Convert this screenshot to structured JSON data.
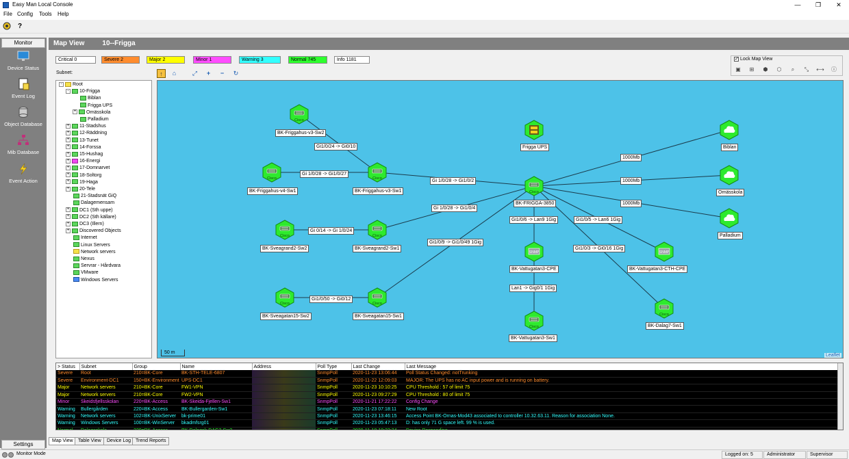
{
  "window": {
    "title": "Easy Man Local Console",
    "minimize": "—",
    "restore": "❐",
    "close": "✕"
  },
  "menu": {
    "file": "File",
    "config": "Config",
    "tools": "Tools",
    "help": "Help"
  },
  "toolbar": {
    "settings_icon": "gear-icon",
    "help_label": "?"
  },
  "monitor": {
    "header": "Monitor",
    "settings": "Settings",
    "items": [
      {
        "label": "Device Status",
        "icon": "monitor-icon"
      },
      {
        "label": "Event Log",
        "icon": "log-icon"
      },
      {
        "label": "Object Database",
        "icon": "database-icon"
      },
      {
        "label": "Mib Database",
        "icon": "network-icon"
      },
      {
        "label": "Event Action",
        "icon": "lightning-icon"
      }
    ]
  },
  "map_header": {
    "title": "Map View",
    "subtitle": "10--Frigga"
  },
  "severity": {
    "critical": "Critical 0",
    "severe": "Severe 2",
    "major": "Major 2",
    "minor": "Minor 1",
    "warning": "Warning 3",
    "normal": "Normal 745",
    "info": "Info 1181",
    "colors": {
      "critical": "#ffffff",
      "severe": "#ff8c2e",
      "major": "#ffff00",
      "minor": "#ff4dff",
      "warning": "#33ffff",
      "normal": "#2eff2e",
      "info": "#ffffff"
    }
  },
  "subnet_label": "Subnet:",
  "tree": [
    {
      "label": "Root",
      "exp": "-",
      "folder": "yellow"
    },
    {
      "label": "10-Frigga",
      "exp": "-",
      "folder": "green"
    },
    {
      "label": "Biblan",
      "exp": "",
      "folder": "green"
    },
    {
      "label": "Frigga UPS",
      "exp": "",
      "folder": "green"
    },
    {
      "label": "Ornässkola",
      "exp": "+",
      "folder": "green"
    },
    {
      "label": "Palladium",
      "exp": "",
      "folder": "green"
    },
    {
      "label": "11-Stadshus",
      "exp": "+",
      "folder": "green"
    },
    {
      "label": "12-Räddning",
      "exp": "+",
      "folder": "green"
    },
    {
      "label": "13-Tunet",
      "exp": "+",
      "folder": "green"
    },
    {
      "label": "14-Forssa",
      "exp": "+",
      "folder": "green"
    },
    {
      "label": "15-Hushag",
      "exp": "+",
      "folder": "green"
    },
    {
      "label": "16-Energi",
      "exp": "+",
      "folder": "magenta"
    },
    {
      "label": "17-Domnarvet",
      "exp": "+",
      "folder": "green"
    },
    {
      "label": "18-Soltorg",
      "exp": "+",
      "folder": "green"
    },
    {
      "label": "19-Haga",
      "exp": "+",
      "folder": "green"
    },
    {
      "label": "20-Tele",
      "exp": "+",
      "folder": "green"
    },
    {
      "label": "21-Stadsnät GiQ",
      "exp": "",
      "folder": "green"
    },
    {
      "label": "Dalagemensam",
      "exp": "",
      "folder": "green"
    },
    {
      "label": "DC1 (Sth uppe)",
      "exp": "+",
      "folder": "green"
    },
    {
      "label": "DC2 (Sth källare)",
      "exp": "+",
      "folder": "green"
    },
    {
      "label": "DC3 (Illern)",
      "exp": "+",
      "folder": "green"
    },
    {
      "label": "Discovered Objects",
      "exp": "+",
      "folder": "green"
    },
    {
      "label": "Internet",
      "exp": "",
      "folder": "green"
    },
    {
      "label": "Linux Servers",
      "exp": "",
      "folder": "green"
    },
    {
      "label": "Network servers",
      "exp": "",
      "folder": "yellow"
    },
    {
      "label": "Nexus",
      "exp": "",
      "folder": "green"
    },
    {
      "label": "Servrar - Hårdvara",
      "exp": "",
      "folder": "green"
    },
    {
      "label": "VMware",
      "exp": "",
      "folder": "green"
    },
    {
      "label": "Windows Servers",
      "exp": "",
      "folder": "blue"
    }
  ],
  "map_tools": [
    "folder-up-icon",
    "home-icon",
    "fit-icon",
    "zoom-in-icon",
    "zoom-out-icon",
    "refresh-icon"
  ],
  "lock": {
    "label": "Lock Map View",
    "checked": "✓"
  },
  "lock_tools": [
    "square-icon",
    "nodes-icon",
    "cube-icon",
    "hexagon-icon",
    "search-icon",
    "link-icon",
    "connect-icon",
    "info-icon",
    "edit-icon"
  ],
  "map": {
    "devices": [
      {
        "id": "fh3",
        "label": "BK-Friggahus-v3-Sw2",
        "kind": "cisco"
      },
      {
        "id": "fh4",
        "label": "BK-Friggahus-v4-Sw1",
        "kind": "cisco"
      },
      {
        "id": "fhs1",
        "label": "BK-Friggahus-v3-Sw1",
        "kind": "cisco"
      },
      {
        "id": "ups",
        "label": "Frigga UPS",
        "kind": "ups"
      },
      {
        "id": "core",
        "label": "BK-FRIGGA-3850",
        "kind": "cisco"
      },
      {
        "id": "bib",
        "label": "Biblan",
        "kind": "cloud"
      },
      {
        "id": "orn",
        "label": "Ornässkola",
        "kind": "cloud"
      },
      {
        "id": "pal",
        "label": "Palladium",
        "kind": "cloud"
      },
      {
        "id": "sv2a",
        "label": "BK-Sveagrand2-Sw2",
        "kind": "cisco"
      },
      {
        "id": "sv2b",
        "label": "BK-Sveagrand2-Sw1",
        "kind": "cisco"
      },
      {
        "id": "vcpe",
        "label": "BK-Vattugatan3-CPE",
        "kind": "snmp"
      },
      {
        "id": "vcth",
        "label": "BK-Vattugatan3-CTH-CPE",
        "kind": "snmp"
      },
      {
        "id": "s15a",
        "label": "BK-Sveagatan15-Sw2",
        "kind": "cisco"
      },
      {
        "id": "s15b",
        "label": "BK-Sveagatan15-Sw1",
        "kind": "cisco"
      },
      {
        "id": "dal",
        "label": "BK-Dalag7-Sw1",
        "kind": "cisco"
      },
      {
        "id": "vsw",
        "label": "BK-Vattugatan3-Sw1",
        "kind": "cisco"
      }
    ],
    "edges": [
      {
        "label": "Gi1/0/24 -> Gi0/10"
      },
      {
        "label": "Gi 1/0/28 -> Gi1/0/27"
      },
      {
        "label": "Gi 1/0/28 -> Gi1/0/2"
      },
      {
        "label": "1000Mb"
      },
      {
        "label": "1000Mb"
      },
      {
        "label": "1000Mb"
      },
      {
        "label": "Gi 1/0/28 -> Gi1/0/4"
      },
      {
        "label": "Gi1/0/6 -> Lan9 1Gig"
      },
      {
        "label": "Gi1/0/5 -> Lan6 1Gig"
      },
      {
        "label": "Gi 0/14 -> Gi 1/0/24"
      },
      {
        "label": "Gi1/0/9 -> Gi1/0/49 1Gig"
      },
      {
        "label": "Gi1/0/3 -> Gi0/16 1Gig"
      },
      {
        "label": "Lan1 -> Gig0/1 1Gig"
      },
      {
        "label": "Gi1/0/50 -> Gi0/12"
      }
    ],
    "cisco_text": "Cisco",
    "snmp_text": "SNMP",
    "scale": "50 m",
    "attribution": "Leaflet"
  },
  "grid": {
    "columns": [
      "> Status",
      "Subnet",
      "Group",
      "Name",
      "Address",
      "Poll Type",
      "Last Change",
      "Last Message"
    ],
    "rows": [
      {
        "color": "#ff8c2e",
        "cells": [
          "Severe",
          "Root",
          "210=BK-Core",
          "BK-STH-TELE-6807",
          "",
          "SnmpPoll",
          "2020-11-23 13:06:44",
          "Poll Status Changed: notTrunking"
        ]
      },
      {
        "color": "#ff8c2e",
        "cells": [
          "Severe",
          "Environment-DC1",
          "150=BK-Environment",
          "UPS-DC1",
          "",
          "SnmpPoll",
          "2020-11-22 12:09:03",
          "MAJOR: The UPS has no AC input power and is running on battery."
        ]
      },
      {
        "color": "#ffff00",
        "cells": [
          "Major",
          "Network servers",
          "210=BK-Core",
          "FW1-VPN",
          "",
          "SnmpPoll",
          "2020-11-23 10:10:25",
          "CPU Threshold : 57 of limit 75"
        ]
      },
      {
        "color": "#ffff00",
        "cells": [
          "Major",
          "Network servers",
          "210=BK-Core",
          "FW2-VPN",
          "",
          "SnmpPoll",
          "2020-11-23 09:27:29",
          "CPU Threshold : 80 of limit 75"
        ]
      },
      {
        "color": "#ff4dff",
        "cells": [
          "Minor",
          "Skeidsfjellsskolan",
          "220=BK-Access",
          "BK-Skeida-Fjellen-Sw1",
          "",
          "SnmpPoll",
          "2020-11-21 17:22:22",
          "Config Change"
        ]
      },
      {
        "color": "#33ffff",
        "cells": [
          "Warning",
          "Bullergården",
          "220=BK-Access",
          "BK-Bullergarden-Sw1",
          "",
          "SnmpPoll",
          "2020-11-23 07:18:11",
          "New Root"
        ]
      },
      {
        "color": "#33ffff",
        "cells": [
          "Warning",
          "Network servers",
          "102=BK-UnixServer",
          "bk-prime01",
          "",
          "SnmpPoll",
          "2020-11-23 13:46:15",
          "Access Point BK-Ornas-Mod43 associated to controller 10.32.63.11. Reason for association None."
        ]
      },
      {
        "color": "#33ffff",
        "cells": [
          "Warning",
          "Windows Servers",
          "100=BK-WinServer",
          "bkadmfsrg01",
          "",
          "SnmpPoll",
          "2020-11-23 05:47:13",
          "D: has only 71 G space left. 99 % is used."
        ]
      },
      {
        "color": "#2eff2e",
        "cells": [
          "Normal",
          "Dalagsskola",
          "220=BK-Access",
          "BK-Dalagsk-DAG3-Sw2",
          "",
          "SnmpPoll",
          "2020-11-18 18:23:24",
          "Device Responding"
        ]
      }
    ]
  },
  "tabs": [
    "Map View",
    "Table View",
    "Device Log",
    "Trend Reports"
  ],
  "status": {
    "mode": "Monitor Mode",
    "logged_on": "Logged on: 5",
    "user": "Administrator",
    "role": "Supervisor"
  }
}
